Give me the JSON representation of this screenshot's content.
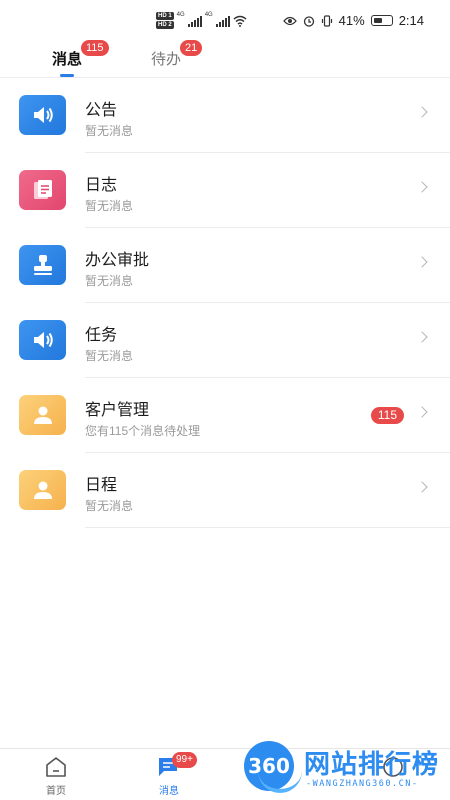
{
  "status_bar": {
    "network_left": [
      "HD 1",
      "HD 2"
    ],
    "signal_label": "4G",
    "battery_text": "41%",
    "time": "2:14"
  },
  "tabs": [
    {
      "label": "消息",
      "badge": "115",
      "active": true
    },
    {
      "label": "待办",
      "badge": "21",
      "active": false
    }
  ],
  "list": [
    {
      "title": "公告",
      "subtitle": "暂无消息",
      "icon": "speaker-icon",
      "color": "#2b82e6",
      "badge": ""
    },
    {
      "title": "日志",
      "subtitle": "暂无消息",
      "icon": "document-icon",
      "color": "#e9557b",
      "badge": ""
    },
    {
      "title": "办公审批",
      "subtitle": "暂无消息",
      "icon": "stamp-icon",
      "color": "#2b82e6",
      "badge": ""
    },
    {
      "title": "任务",
      "subtitle": "暂无消息",
      "icon": "speaker-icon",
      "color": "#2b82e6",
      "badge": ""
    },
    {
      "title": "客户管理",
      "subtitle": "您有115个消息待处理",
      "icon": "person-icon",
      "color": "#f7bb5c",
      "badge": "115"
    },
    {
      "title": "日程",
      "subtitle": "暂无消息",
      "icon": "person-icon",
      "color": "#f7bb5c",
      "badge": ""
    }
  ],
  "bottom_nav": [
    {
      "label": "首页",
      "icon": "home-icon",
      "active": false,
      "badge": ""
    },
    {
      "label": "消息",
      "icon": "chat-icon",
      "active": true,
      "badge": "99+"
    },
    {
      "label": "",
      "icon": "contacts-icon",
      "active": false,
      "badge": ""
    },
    {
      "label": "",
      "icon": "profile-icon",
      "active": false,
      "badge": ""
    }
  ],
  "watermark": {
    "logo_text": "360",
    "title": "网站排行榜",
    "subtitle": "-WANGZHANG360.CN-"
  },
  "colors": {
    "accent": "#2b7de9",
    "badge": "#e84a4a"
  }
}
